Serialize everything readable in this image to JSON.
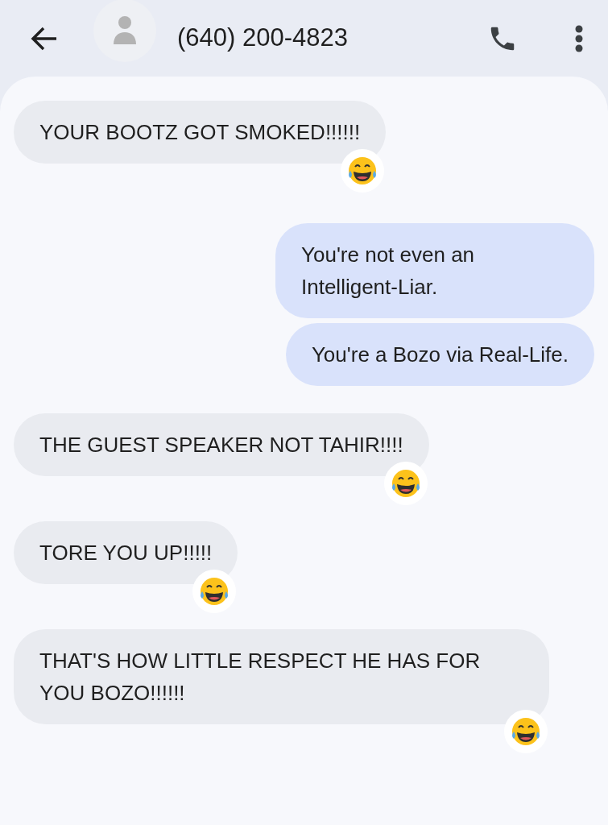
{
  "header": {
    "title": "(640) 200-4823"
  },
  "messages": [
    {
      "kind": "incoming",
      "text": "YOUR BOOTZ GOT SMOKED!!!!!!",
      "reacted": true
    },
    {
      "kind": "outgoing",
      "text": "You're not even an Intelligent-Liar.",
      "reacted": false
    },
    {
      "kind": "outgoing",
      "text": "You're a Bozo via Real-Life.",
      "reacted": false
    },
    {
      "kind": "incoming",
      "text": "THE GUEST SPEAKER NOT TAHIR!!!!",
      "reacted": true
    },
    {
      "kind": "incoming",
      "text": "TORE YOU UP!!!!!",
      "reacted": true
    },
    {
      "kind": "incoming",
      "text": "THAT'S HOW LITTLE RESPECT HE HAS FOR YOU BOZO!!!!!!",
      "reacted": true
    }
  ]
}
